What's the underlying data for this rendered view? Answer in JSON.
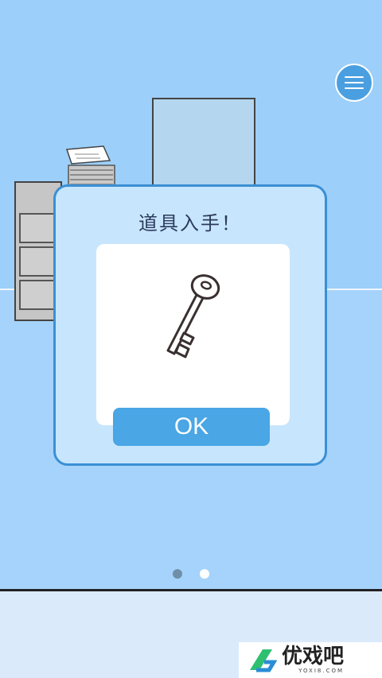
{
  "dialog": {
    "title": "道具入手！",
    "item": "key-icon",
    "ok_label": "OK"
  },
  "menu": {
    "icon": "menu-icon"
  },
  "pagination": {
    "total": 2,
    "current": 1
  },
  "watermark": {
    "text": "优戏吧",
    "sub": "YOXI8.COM"
  },
  "colors": {
    "wall": "#9ccffa",
    "floor": "#a6d3fb",
    "dialog_bg": "#c7e6fd",
    "dialog_border": "#3b8fd4",
    "ok_button": "#4aa6e4",
    "bottom_bar": "#dbeafb"
  }
}
